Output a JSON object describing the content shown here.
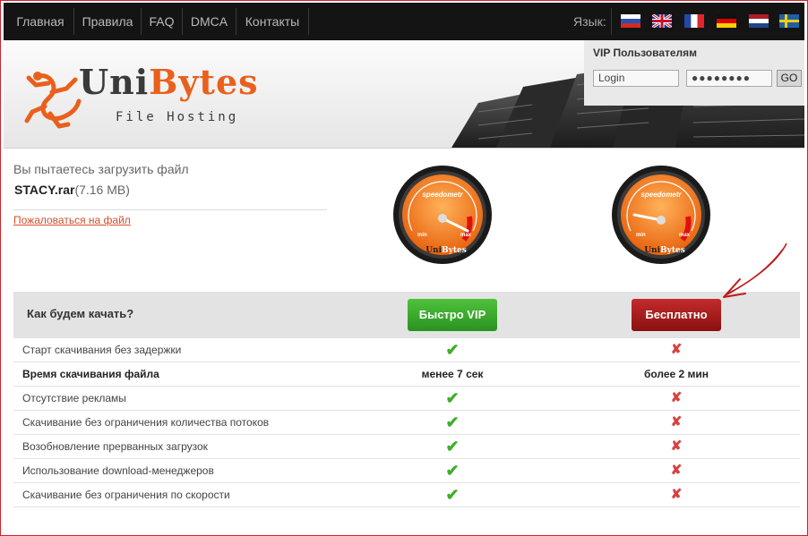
{
  "nav": {
    "items": [
      "Главная",
      "Правила",
      "FAQ",
      "DMCA",
      "Контакты"
    ],
    "lang_label": "Язык:",
    "flags": [
      "russian-flag-icon",
      "uk-flag-icon",
      "french-flag-icon",
      "german-flag-icon",
      "dutch-flag-icon",
      "swedish-flag-icon"
    ]
  },
  "logo": {
    "name_part1": "Uni",
    "name_part2": "Bytes",
    "subtitle": "File Hosting"
  },
  "vip": {
    "title": "VIP Пользователям",
    "login_placeholder": "Login",
    "password_value": "●●●●●●●●",
    "go_label": "GO"
  },
  "file": {
    "prompt": "Вы пытаетесь загрузить файл",
    "name": "STACY.rar",
    "size": "(7.16 MB)",
    "complain_link": "Пожаловаться на файл"
  },
  "gauges": {
    "label": "speedometr",
    "min": "min",
    "max": "max",
    "brand_part1": "Uni",
    "brand_part2": "Bytes"
  },
  "table": {
    "question": "Как будем качать?",
    "vip_button": "Быстро VIP",
    "free_button": "Бесплатно",
    "rows": [
      {
        "label": "Старт скачивания без задержки",
        "vip": "check",
        "free": "cross"
      },
      {
        "label": "Время скачивания файла",
        "vip": "менее 7 сек",
        "free": "более 2 мин",
        "bold": true
      },
      {
        "label": "Отсутствие рекламы",
        "vip": "check",
        "free": "cross"
      },
      {
        "label": "Скачивание без ограничения количества потоков",
        "vip": "check",
        "free": "cross"
      },
      {
        "label": "Возобновление прерванных загрузок",
        "vip": "check",
        "free": "cross"
      },
      {
        "label": "Использование download-менеджеров",
        "vip": "check",
        "free": "cross"
      },
      {
        "label": "Скачивание без ограничения по скорости",
        "vip": "check",
        "free": "cross"
      }
    ]
  },
  "colors": {
    "accent": "#e9601d",
    "vip_green": "#2a9220",
    "free_red": "#8a1010",
    "nav_bg": "#141414"
  }
}
